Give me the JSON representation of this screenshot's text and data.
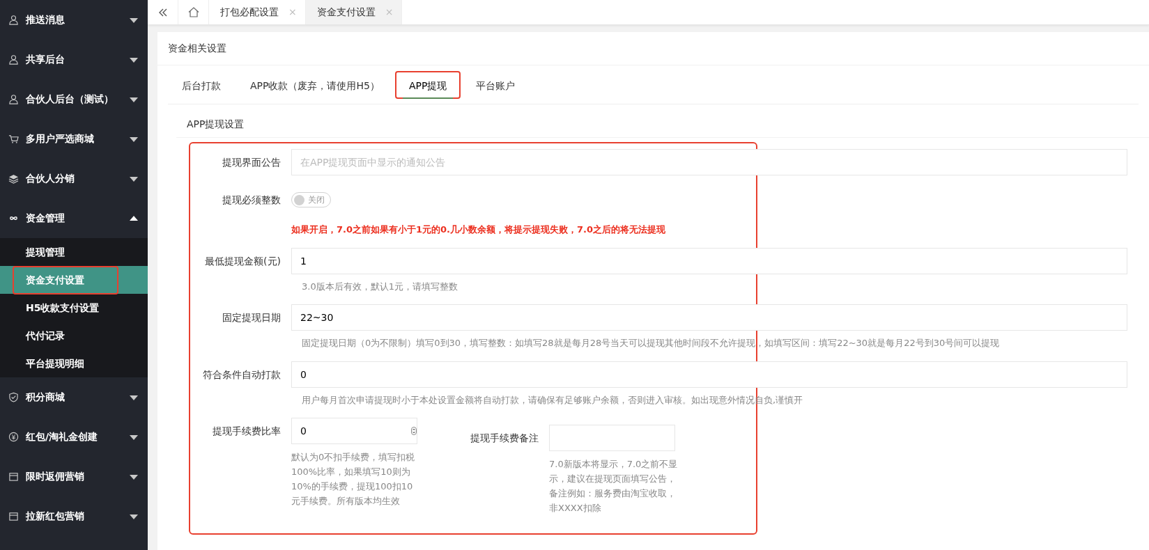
{
  "sidebar": {
    "items": [
      {
        "label": "推送消息",
        "expanded": false
      },
      {
        "label": "共享后台",
        "expanded": false
      },
      {
        "label": "合伙人后台（测试）",
        "expanded": false
      },
      {
        "label": "多用户严选商城",
        "expanded": false
      },
      {
        "label": "合伙人分销",
        "expanded": false
      },
      {
        "label": "资金管理",
        "expanded": true,
        "children": [
          {
            "label": "提现管理",
            "selected": false,
            "highlighted": false
          },
          {
            "label": "资金支付设置",
            "selected": true,
            "highlighted": true
          },
          {
            "label": "H5收款支付设置",
            "selected": false,
            "highlighted": false
          },
          {
            "label": "代付记录",
            "selected": false,
            "highlighted": false
          },
          {
            "label": "平台提现明细",
            "selected": false,
            "highlighted": false
          }
        ]
      },
      {
        "label": "积分商城",
        "expanded": false
      },
      {
        "label": "红包/淘礼金创建",
        "expanded": false
      },
      {
        "label": "限时返佣营销",
        "expanded": false
      },
      {
        "label": "拉新红包营销",
        "expanded": false
      }
    ]
  },
  "page_tabs": [
    {
      "label": "打包必配设置",
      "selected": false,
      "close": "×"
    },
    {
      "label": "资金支付设置",
      "selected": true,
      "close": "×"
    }
  ],
  "card": {
    "title": "资金相关设置",
    "tabs": [
      {
        "label": "后台打款",
        "selected": false,
        "highlighted": false
      },
      {
        "label": "APP收款（废弃，请使用H5）",
        "selected": false,
        "highlighted": false
      },
      {
        "label": "APP提现",
        "selected": true,
        "highlighted": true
      },
      {
        "label": "平台账户",
        "selected": false,
        "highlighted": false
      }
    ],
    "section_title": "APP提现设置",
    "form": {
      "highlighted": true,
      "rows": [
        {
          "kind": "input",
          "label": "提现界面公告",
          "placeholder": "在APP提现页面中显示的通知公告"
        },
        {
          "kind": "switch",
          "label": "提现必须整数",
          "on": false,
          "switch_text": "关闭",
          "warning": "如果开启，7.0之前如果有小于1元的0.几小数余额，将提示提现失败，7.0之后的将无法提现"
        },
        {
          "kind": "input",
          "label": "最低提现金额(元)",
          "value": "1",
          "hint": "3.0版本后有效，默认1元，请填写整数"
        },
        {
          "kind": "input",
          "label": "固定提现日期",
          "value": "22~30",
          "hint": "固定提现日期（0为不限制）填写0到30，填写整数：如填写28就是每月28号当天可以提现其他时间段不允许提现，如填写区间：填写22~30就是每月22号到30号间可以提现"
        },
        {
          "kind": "input",
          "label": "符合条件自动打款",
          "value": "0",
          "hint": "用户每月首次申请提现时小于本处设置金额将自动打款，请确保有足够账户余额，否则进入审核。如出现意外情况自负,谨慎开"
        },
        {
          "kind": "pair",
          "fields": [
            {
              "kind": "number",
              "label": "提现手续费比率",
              "value": "0",
              "hint": "默认为0不扣手续费，填写扣税100%比率，如果填写10则为10%的手续费，提现100扣10元手续费。所有版本均生效"
            },
            {
              "kind": "text",
              "label": "提现手续费备注",
              "hint": "7.0新版本将显示，7.0之前不显示，建议在提现页面填写公告，备注例如：服务费由淘宝收取，非XXXX扣除"
            }
          ]
        }
      ]
    }
  }
}
